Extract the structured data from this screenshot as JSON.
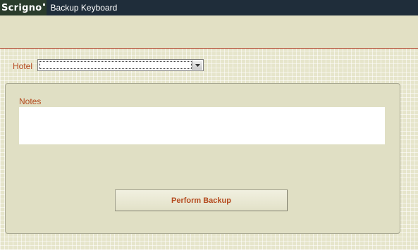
{
  "app": {
    "logo_text": "Scrigno",
    "window_title": "Backup Keyboard"
  },
  "form": {
    "hotel_label": "Hotel",
    "hotel_value": "",
    "notes_label": "Notes",
    "notes_value": "",
    "perform_button_label": "Perform Backup"
  },
  "icons": {
    "dropdown": "chevron-down-icon"
  },
  "colors": {
    "label_accent": "#b44a1e",
    "titlebar_bg": "#1f2d3a",
    "divider": "#b0402a"
  }
}
